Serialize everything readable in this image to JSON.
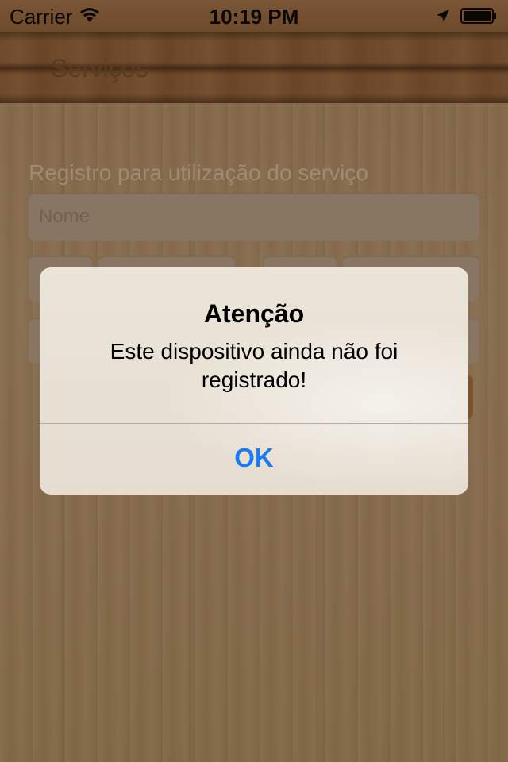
{
  "status_bar": {
    "carrier": "Carrier",
    "time": "10:19 PM"
  },
  "nav": {
    "title": "Serviços"
  },
  "form": {
    "section_label": "Registro para utilização do serviço",
    "name_placeholder": "Nome"
  },
  "alert": {
    "title": "Atenção",
    "message": "Este dispositivo ainda não foi registrado!",
    "ok_label": "OK",
    "ok_color": "#1a7cf2"
  },
  "icons": {
    "wifi": "wifi-icon",
    "location": "location-arrow-icon",
    "battery": "battery-icon"
  }
}
